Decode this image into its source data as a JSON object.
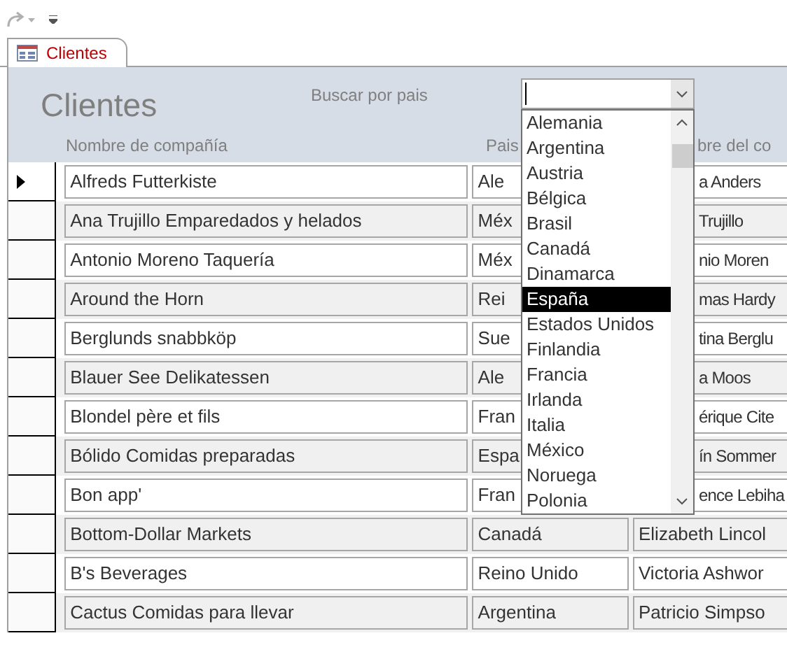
{
  "tab": {
    "label": "Clientes",
    "selected": true
  },
  "form_title": "Clientes",
  "search": {
    "label": "Buscar por pais"
  },
  "columns": [
    "Nombre de compañía",
    "Pais",
    "bre del co"
  ],
  "rows": [
    {
      "company": "Alfreds Futterkiste",
      "country": "Ale",
      "contact": "a Anders",
      "current": true
    },
    {
      "company": "Ana Trujillo Emparedados y helados",
      "country": "Méx",
      "contact": "Trujillo",
      "current": false
    },
    {
      "company": "Antonio Moreno Taquería",
      "country": "Méx",
      "contact": "nio Moren",
      "current": false
    },
    {
      "company": "Around the Horn",
      "country": "Rei",
      "contact": "mas Hardy",
      "current": false
    },
    {
      "company": "Berglunds snabbköp",
      "country": "Sue",
      "contact": "tina Berglu",
      "current": false
    },
    {
      "company": "Blauer See Delikatessen",
      "country": "Ale",
      "contact": "a Moos",
      "current": false
    },
    {
      "company": "Blondel père et fils",
      "country": "Fran",
      "contact": "érique Cite",
      "current": false
    },
    {
      "company": "Bólido Comidas preparadas",
      "country": "Espa",
      "contact": "ín Sommer",
      "current": false
    },
    {
      "company": "Bon app'",
      "country": "Fran",
      "contact": "ence Lebiha",
      "current": false
    },
    {
      "company": "Bottom-Dollar Markets",
      "country": "Canadá",
      "contact": "Elizabeth Lincol",
      "current": false
    },
    {
      "company": "B's Beverages",
      "country": "Reino Unido",
      "contact": "Victoria Ashwor",
      "current": false
    },
    {
      "company": "Cactus Comidas para llevar",
      "country": "Argentina",
      "contact": "Patricio Simpso",
      "current": false
    }
  ],
  "dropdown": {
    "items": [
      {
        "label": "Alemania",
        "selected": false
      },
      {
        "label": "Argentina",
        "selected": false
      },
      {
        "label": "Austria",
        "selected": false
      },
      {
        "label": "Bélgica",
        "selected": false
      },
      {
        "label": "Brasil",
        "selected": false
      },
      {
        "label": "Canadá",
        "selected": false
      },
      {
        "label": "Dinamarca",
        "selected": false
      },
      {
        "label": "España",
        "selected": true
      },
      {
        "label": "Estados Unidos",
        "selected": false
      },
      {
        "label": "Finlandia",
        "selected": false
      },
      {
        "label": "Francia",
        "selected": false
      },
      {
        "label": "Irlanda",
        "selected": false
      },
      {
        "label": "Italia",
        "selected": false
      },
      {
        "label": "México",
        "selected": false
      },
      {
        "label": "Noruega",
        "selected": false
      },
      {
        "label": "Polonia",
        "selected": false
      }
    ]
  }
}
